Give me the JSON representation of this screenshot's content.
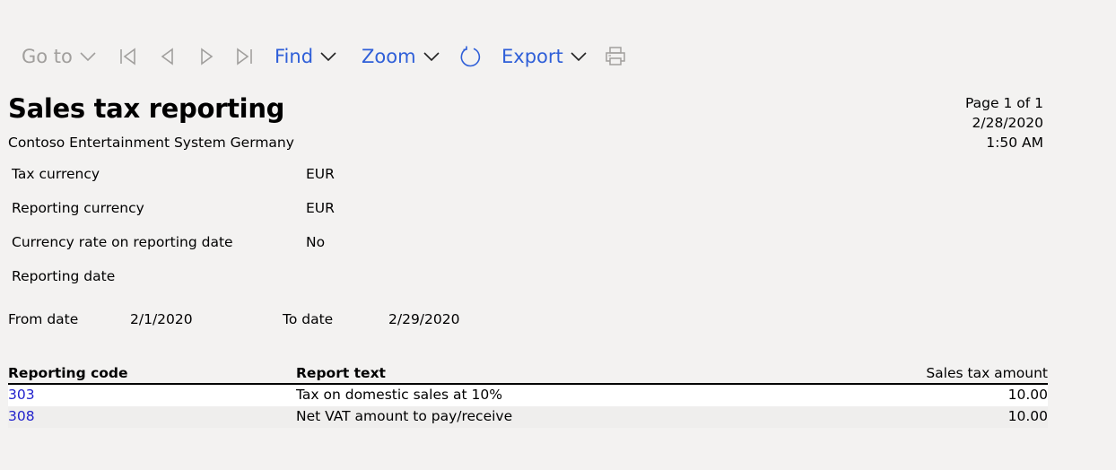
{
  "toolbar": {
    "goto_label": "Go to",
    "find_label": "Find",
    "zoom_label": "Zoom",
    "export_label": "Export",
    "colors": {
      "active": "#2f5fd8",
      "disabled": "#a19f9d"
    }
  },
  "header": {
    "title": "Sales tax reporting",
    "company": "Contoso Entertainment System Germany",
    "page_info": "Page 1 of 1",
    "date": "2/28/2020",
    "time": "1:50 AM"
  },
  "parameters": [
    {
      "label": "Tax currency",
      "value": "EUR"
    },
    {
      "label": "Reporting currency",
      "value": "EUR"
    },
    {
      "label": "Currency rate on reporting date",
      "value": "No"
    },
    {
      "label": "Reporting date",
      "value": ""
    }
  ],
  "date_range": {
    "from_label": "From date",
    "from_value": "2/1/2020",
    "to_label": "To date",
    "to_value": "2/29/2020"
  },
  "table": {
    "columns": {
      "code": "Reporting code",
      "text": "Report text",
      "amount": "Sales tax amount"
    },
    "rows": [
      {
        "code": "303",
        "text": "Tax on domestic sales at 10%",
        "amount": "10.00"
      },
      {
        "code": "308",
        "text": "Net VAT amount to pay/receive",
        "amount": "10.00"
      }
    ],
    "link_color": "#2222cc"
  }
}
